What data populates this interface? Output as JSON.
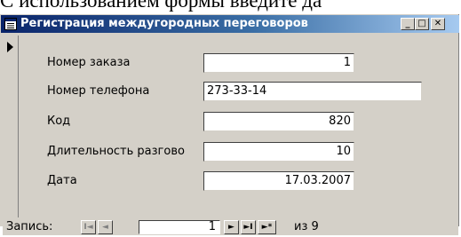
{
  "document": {
    "overflow_text": "С использованием формы введите да"
  },
  "window": {
    "title": "Регистрация междугородных переговоров",
    "buttons": {
      "minimize": "_",
      "maximize": "□",
      "close": "✕"
    }
  },
  "form": {
    "fields": [
      {
        "label": "Номер заказа",
        "value": "1",
        "align": "right"
      },
      {
        "label": "Номер телефона",
        "value": "273-33-14",
        "align": "left"
      },
      {
        "label": "Код",
        "value": "820",
        "align": "right"
      },
      {
        "label": "Длительность разгово",
        "value": "10",
        "align": "right"
      },
      {
        "label": "Дата",
        "value": "17.03.2007",
        "align": "right"
      }
    ]
  },
  "navigation": {
    "label": "Запись:",
    "first": "I◄",
    "prev": "◄",
    "current": "1",
    "next": "►",
    "last": "►I",
    "new": "►*",
    "total_text": "из 9"
  },
  "colors": {
    "titlebar_start": "#0a246a",
    "titlebar_end": "#a6caf0",
    "face": "#d4d0c8"
  },
  "icons": {
    "window_icon": "form-icon",
    "record_selector": "current-record-arrow-icon"
  }
}
